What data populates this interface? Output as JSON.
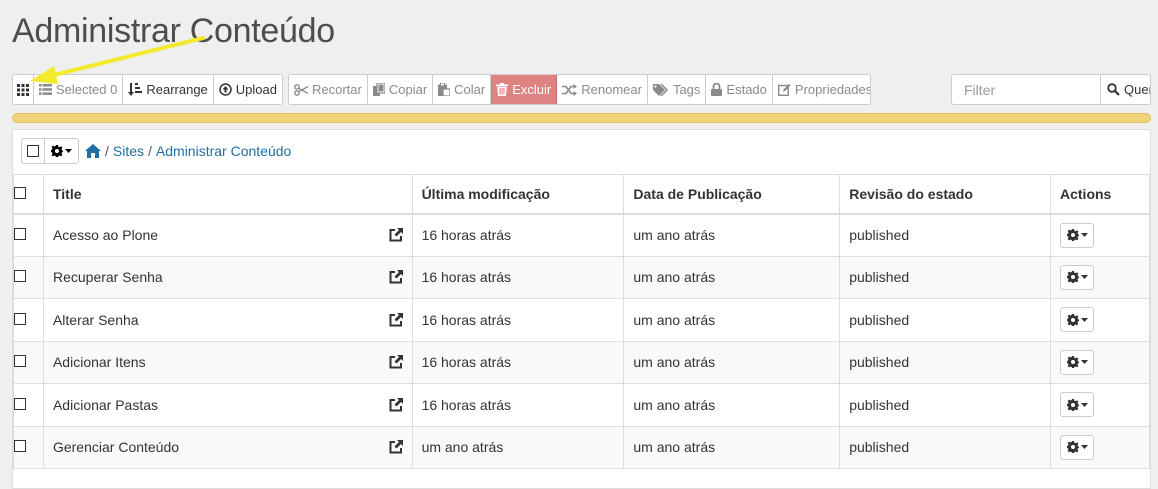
{
  "page_title": "Administrar Conteúdo",
  "toolbar": {
    "grid_icon": "grid-icon",
    "selected_label": "Selected 0",
    "rearrange_label": "Rearrange",
    "upload_label": "Upload",
    "cut_label": "Recortar",
    "copy_label": "Copiar",
    "paste_label": "Colar",
    "delete_label": "Excluir",
    "rename_label": "Renomear",
    "tags_label": "Tags",
    "state_label": "Estado",
    "properties_label": "Propriedades"
  },
  "filter": {
    "placeholder": "Filter",
    "query_label": "Query"
  },
  "breadcrumb": {
    "home_icon": "home-icon",
    "sites": "Sites",
    "current": "Administrar Conteúdo",
    "separator": "/"
  },
  "table": {
    "headers": {
      "title": "Title",
      "modified": "Última modificação",
      "published": "Data de Publicação",
      "state": "Revisão do estado",
      "actions": "Actions"
    },
    "rows": [
      {
        "title": "Acesso ao Plone",
        "modified": "16 horas atrás",
        "published": "um ano atrás",
        "state": "published"
      },
      {
        "title": "Recuperar Senha",
        "modified": "16 horas atrás",
        "published": "um ano atrás",
        "state": "published"
      },
      {
        "title": "Alterar Senha",
        "modified": "16 horas atrás",
        "published": "um ano atrás",
        "state": "published"
      },
      {
        "title": "Adicionar Itens",
        "modified": "16 horas atrás",
        "published": "um ano atrás",
        "state": "published"
      },
      {
        "title": "Adicionar Pastas",
        "modified": "16 horas atrás",
        "published": "um ano atrás",
        "state": "published"
      },
      {
        "title": "Gerenciar Conteúdo",
        "modified": "um ano atrás",
        "published": "um ano atrás",
        "state": "published"
      }
    ]
  },
  "colors": {
    "delete_button": "#df8282",
    "progress_bar": "#f0d27a",
    "link": "#1d6fa8",
    "arrow": "#f2ea2a"
  }
}
